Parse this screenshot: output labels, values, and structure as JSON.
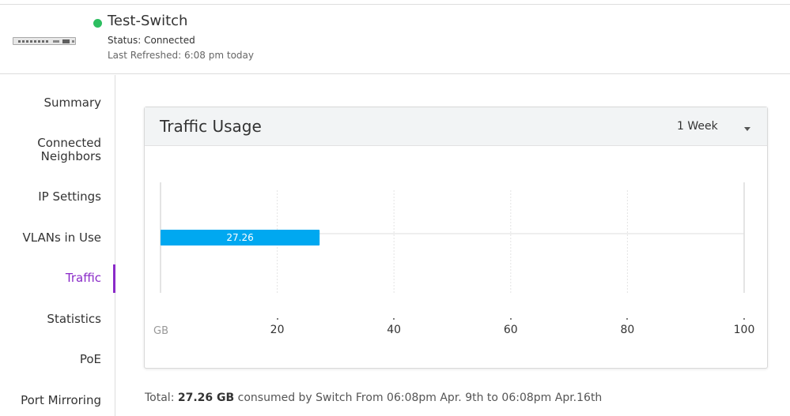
{
  "device": {
    "name": "Test-Switch",
    "status": "Status: Connected",
    "last_refreshed": "Last Refreshed: 6:08 pm today",
    "status_color": "#2dbe60"
  },
  "sidebar": {
    "items": [
      {
        "label": "Summary"
      },
      {
        "label": "Connected\nNeighbors"
      },
      {
        "label": "IP Settings"
      },
      {
        "label": "VLANs in Use"
      },
      {
        "label": "Traffic",
        "active": true
      },
      {
        "label": "Statistics"
      },
      {
        "label": "PoE"
      },
      {
        "label": "Port Mirroring"
      }
    ],
    "active_color": "#8a2ac8"
  },
  "card": {
    "title": "Traffic Usage",
    "range": "1 Week"
  },
  "chart_data": {
    "type": "bar",
    "orientation": "horizontal",
    "values": [
      27.26
    ],
    "value_label": "27.26",
    "unit": "GB",
    "xlim": [
      0,
      100
    ],
    "ticks": [
      20,
      40,
      60,
      80,
      100
    ],
    "bar_color": "#00a8f0",
    "grid": true
  },
  "footer": {
    "prefix": "Total: ",
    "total": "27.26 GB",
    "suffix": " consumed by Switch From 06:08pm Apr. 9th to 06:08pm Apr.16th"
  }
}
